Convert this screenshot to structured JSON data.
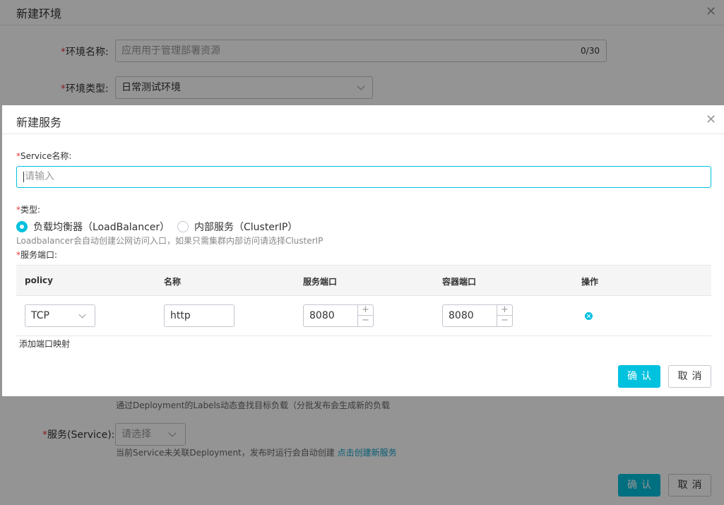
{
  "bg_dialog": {
    "title": "新建环境",
    "env_name": {
      "required": "*",
      "label": "环境名称:",
      "placeholder": "应用用于管理部署资源",
      "counter": "0/30"
    },
    "env_type": {
      "required": "*",
      "label": "环境类型:",
      "value": "日常测试环境"
    },
    "help_labels": "通过Deployment的Labels动态查找目标负载（分批发布会生成新的负载",
    "service": {
      "required": "*",
      "label": "服务(Service):",
      "placeholder": "请选择"
    },
    "service_help": "当前Service未关联Deployment，发布时运行会自动创建",
    "service_link": "点击创建新服务",
    "confirm_label": "确认",
    "cancel_label": "取消"
  },
  "dialog": {
    "title": "新建服务",
    "service_name": {
      "required": "*",
      "label": "Service名称:",
      "placeholder": "请输入"
    },
    "type": {
      "required": "*",
      "label": "类型:",
      "options": [
        "负载均衡器（LoadBalancer）",
        "内部服务（ClusterIP）"
      ],
      "selected": "负载均衡器（LoadBalancer）",
      "help": "Loadbalancer会自动创建公网访问入口，如果只需集群内部访问请选择ClusterIP"
    },
    "ports": {
      "required": "*",
      "label": "服务端口:",
      "columns": [
        "policy",
        "名称",
        "服务端口",
        "容器端口",
        "操作"
      ],
      "rows": [
        {
          "policy": "TCP",
          "name": "http",
          "service_port": "8080",
          "container_port": "8080"
        }
      ],
      "add_link": "添加端口映射"
    },
    "stepper_up": "+",
    "stepper_down": "−",
    "confirm_label": "确认",
    "cancel_label": "取消"
  },
  "icons": {
    "close": "close-icon",
    "delete": "delete-icon",
    "chevron": "chevron-down-icon"
  },
  "colors": {
    "accent": "#00c1de",
    "required": "#e4393c",
    "link": "#0fa0c8"
  }
}
